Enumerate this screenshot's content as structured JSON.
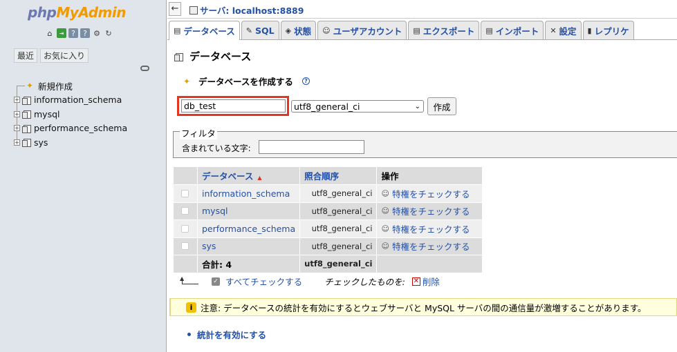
{
  "app": {
    "logo_php": "php",
    "logo_my": "My",
    "logo_admin": "Admin",
    "nav_icons": [
      "home-icon",
      "logout-icon",
      "docs-icon",
      "sql-doc-icon",
      "settings-icon",
      "reload-icon"
    ]
  },
  "left": {
    "tab_recent": "最近",
    "tab_favorites": "お気に入り",
    "tree": [
      {
        "label": "新規作成",
        "type": "new"
      },
      {
        "label": "information_schema",
        "type": "db"
      },
      {
        "label": "mysql",
        "type": "db"
      },
      {
        "label": "performance_schema",
        "type": "db"
      },
      {
        "label": "sys",
        "type": "db"
      }
    ]
  },
  "topbar": {
    "back_label": "←",
    "server": "サーバ: localhost:8889"
  },
  "tabs": [
    {
      "label": "データベース",
      "icon": "database-icon",
      "active": true
    },
    {
      "label": "SQL",
      "icon": "sql-icon",
      "active": false
    },
    {
      "label": "状態",
      "icon": "status-icon",
      "active": false
    },
    {
      "label": "ユーザアカウント",
      "icon": "users-icon",
      "active": false
    },
    {
      "label": "エクスポート",
      "icon": "export-icon",
      "active": false
    },
    {
      "label": "インポート",
      "icon": "import-icon",
      "active": false
    },
    {
      "label": "設定",
      "icon": "settings-icon",
      "active": false
    },
    {
      "label": "レプリケ",
      "icon": "replication-icon",
      "active": false
    }
  ],
  "main": {
    "title": "データベース",
    "create_title": "データベースを作成する",
    "help": "?",
    "dbname_value": "db_test",
    "collation_value": "utf8_general_ci",
    "create_button": "作成",
    "filter_legend": "フィルタ",
    "filter_label": "含まれている文字:",
    "filter_value": ""
  },
  "table": {
    "headers": {
      "name": "データベース",
      "collation": "照合順序",
      "action": "操作"
    },
    "rows": [
      {
        "name": "information_schema",
        "collation": "utf8_general_ci",
        "action": "特権をチェックする"
      },
      {
        "name": "mysql",
        "collation": "utf8_general_ci",
        "action": "特権をチェックする"
      },
      {
        "name": "performance_schema",
        "collation": "utf8_general_ci",
        "action": "特権をチェックする"
      },
      {
        "name": "sys",
        "collation": "utf8_general_ci",
        "action": "特権をチェックする"
      }
    ],
    "footer": {
      "total": "合計: 4",
      "collation": "utf8_general_ci"
    }
  },
  "bulk": {
    "check_all": "すべてチェックする",
    "with_selected": "チェックしたものを:",
    "delete": "削除"
  },
  "notice": {
    "icon": "i",
    "text": "注意: データベースの統計を有効にするとウェブサーバと MySQL サーバの間の通信量が激増することがあります。"
  },
  "enable_stats": "統計を有効にする"
}
